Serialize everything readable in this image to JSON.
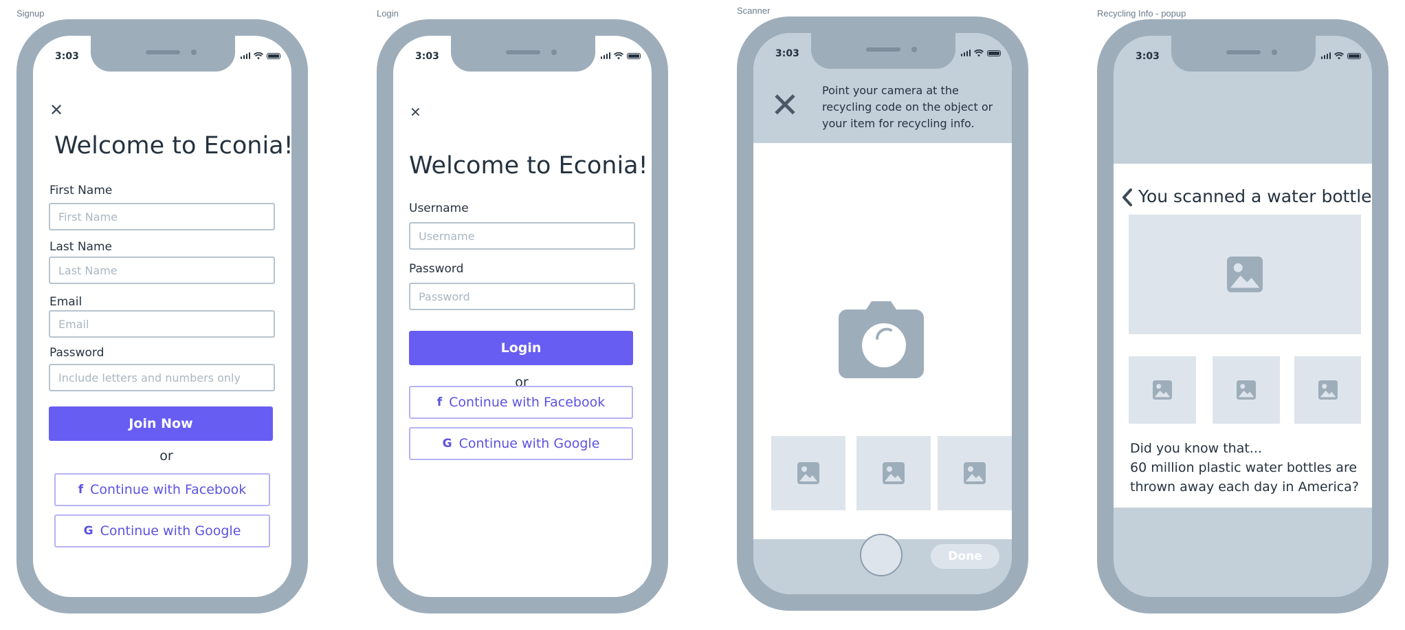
{
  "frames": {
    "signup": {
      "label": "Signup"
    },
    "login": {
      "label": "Login"
    },
    "scanner": {
      "label": "Scanner"
    },
    "recycling": {
      "label": "Recycling Info - popup"
    }
  },
  "status_bar": {
    "time": "3:03"
  },
  "signup": {
    "title": "Welcome to Econia!",
    "first_name_label": "First Name",
    "first_name_placeholder": "First Name",
    "last_name_label": "Last Name",
    "last_name_placeholder": "Last Name",
    "email_label": "Email",
    "email_placeholder": "Email",
    "password_label": "Password",
    "password_placeholder": "Include letters and numbers only",
    "join_button": "Join Now",
    "or": "or",
    "facebook_button": "Continue with Facebook",
    "google_button": "Continue with Google"
  },
  "login": {
    "title": "Welcome to Econia!",
    "username_label": "Username",
    "username_placeholder": "Username",
    "password_label": "Password",
    "password_placeholder": "Password",
    "login_button": "Login",
    "or": "or",
    "facebook_button": "Continue with Facebook",
    "google_button": "Continue with Google"
  },
  "scanner": {
    "instruction": "Point your camera at the recycling code on the object or your item for recycling info.",
    "done_button": "Done"
  },
  "recycling": {
    "heading": "You scanned a water bottle",
    "fact_intro": "Did you know that...",
    "fact_body": "60 million plastic water bottles are thrown away each day in America?"
  },
  "icons": {
    "close": "close-icon",
    "facebook": "facebook-icon",
    "google": "google-icon",
    "camera": "camera-icon",
    "image": "image-placeholder-icon",
    "back": "chevron-left-icon"
  },
  "colors": {
    "primary": "#685df2",
    "phone_frame": "#9eadba",
    "panel": "#c3cfd9",
    "placeholder_fill": "#dde4ec",
    "text": "#25323f"
  }
}
